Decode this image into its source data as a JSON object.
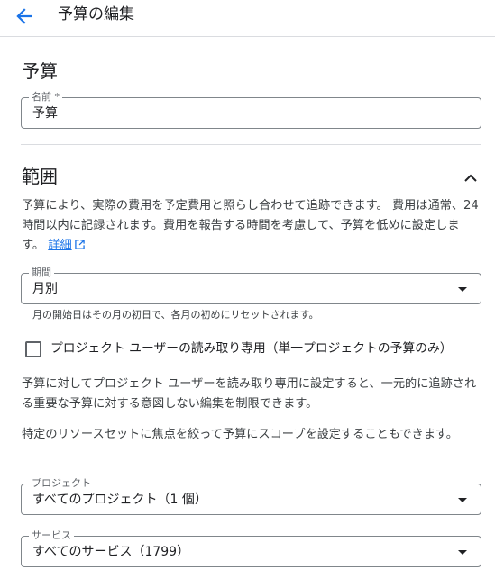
{
  "header": {
    "title": "予算の編集",
    "back_icon": "arrow-back-icon"
  },
  "budget": {
    "heading": "予算",
    "name_field": {
      "label": "名前 *",
      "value": "予算"
    }
  },
  "scope": {
    "heading": "範囲",
    "collapse_icon": "chevron-up-icon",
    "description": "予算により、実際の費用を予定費用と照らし合わせて追跡できます。 費用は通常、24 時間以内に記録されます。費用を報告する時間を考慮して、予算を低めに設定します。",
    "details_link": "詳細",
    "period_field": {
      "label": "期間",
      "value": "月別"
    },
    "period_helper": "月の開始日はその月の初日で、各月の初めにリセットされます。",
    "readonly_checkbox": {
      "label": "プロジェクト ユーザーの読み取り専用（単一プロジェクトの予算のみ）",
      "checked": false
    },
    "readonly_description": "予算に対してプロジェクト ユーザーを読み取り専用に設定すると、一元的に追跡される重要な予算に対する意図しない編集を制限できます。",
    "resource_description": "特定のリソースセットに焦点を絞って予算にスコープを設定することもできます。",
    "projects_field": {
      "label": "プロジェクト",
      "value": "すべてのプロジェクト（1 個）"
    },
    "services_field": {
      "label": "サービス",
      "value": "すべてのサービス（1799）"
    }
  },
  "colors": {
    "accent": "#1a73e8",
    "text": "#202124",
    "border": "#80868b",
    "divider": "#dadce0"
  }
}
